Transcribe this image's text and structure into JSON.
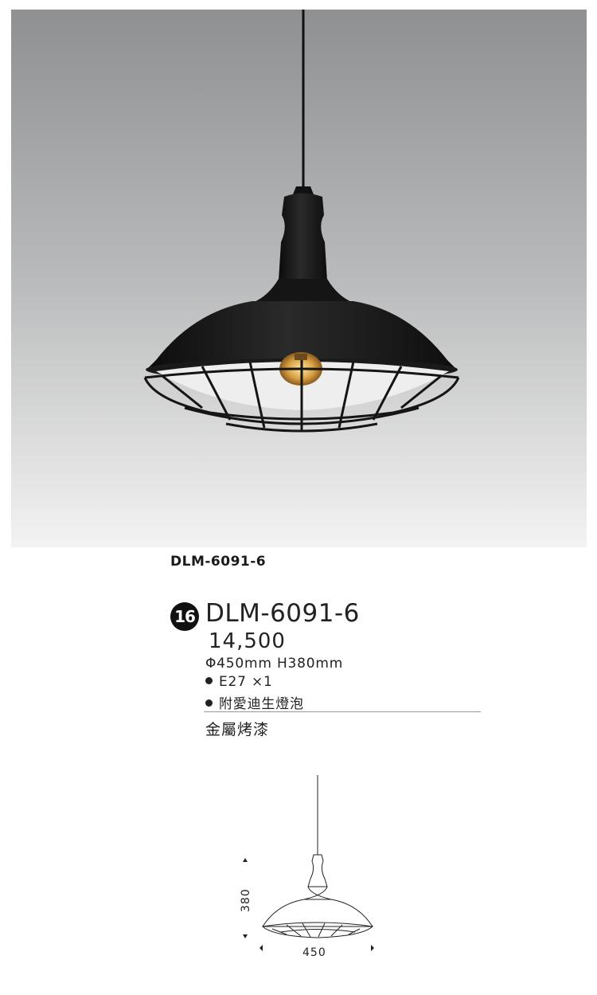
{
  "caption": {
    "model": "DLM-6091-6"
  },
  "badge": {
    "number": "16"
  },
  "product": {
    "model": "DLM-6091-6",
    "price": "14,500",
    "dimensions": "Φ450mm H380mm",
    "bulb": "E27 ×1",
    "included": "附愛迪生燈泡",
    "finish": "金屬烤漆"
  },
  "diagram": {
    "height_label": "380",
    "width_label": "450"
  },
  "colors": {
    "background": "#ffffff",
    "photo_bg_top": "#8e9092",
    "photo_bg_bottom": "#f3f3f3",
    "lamp": "#141414",
    "bulb_glow": "#e0b45a"
  }
}
